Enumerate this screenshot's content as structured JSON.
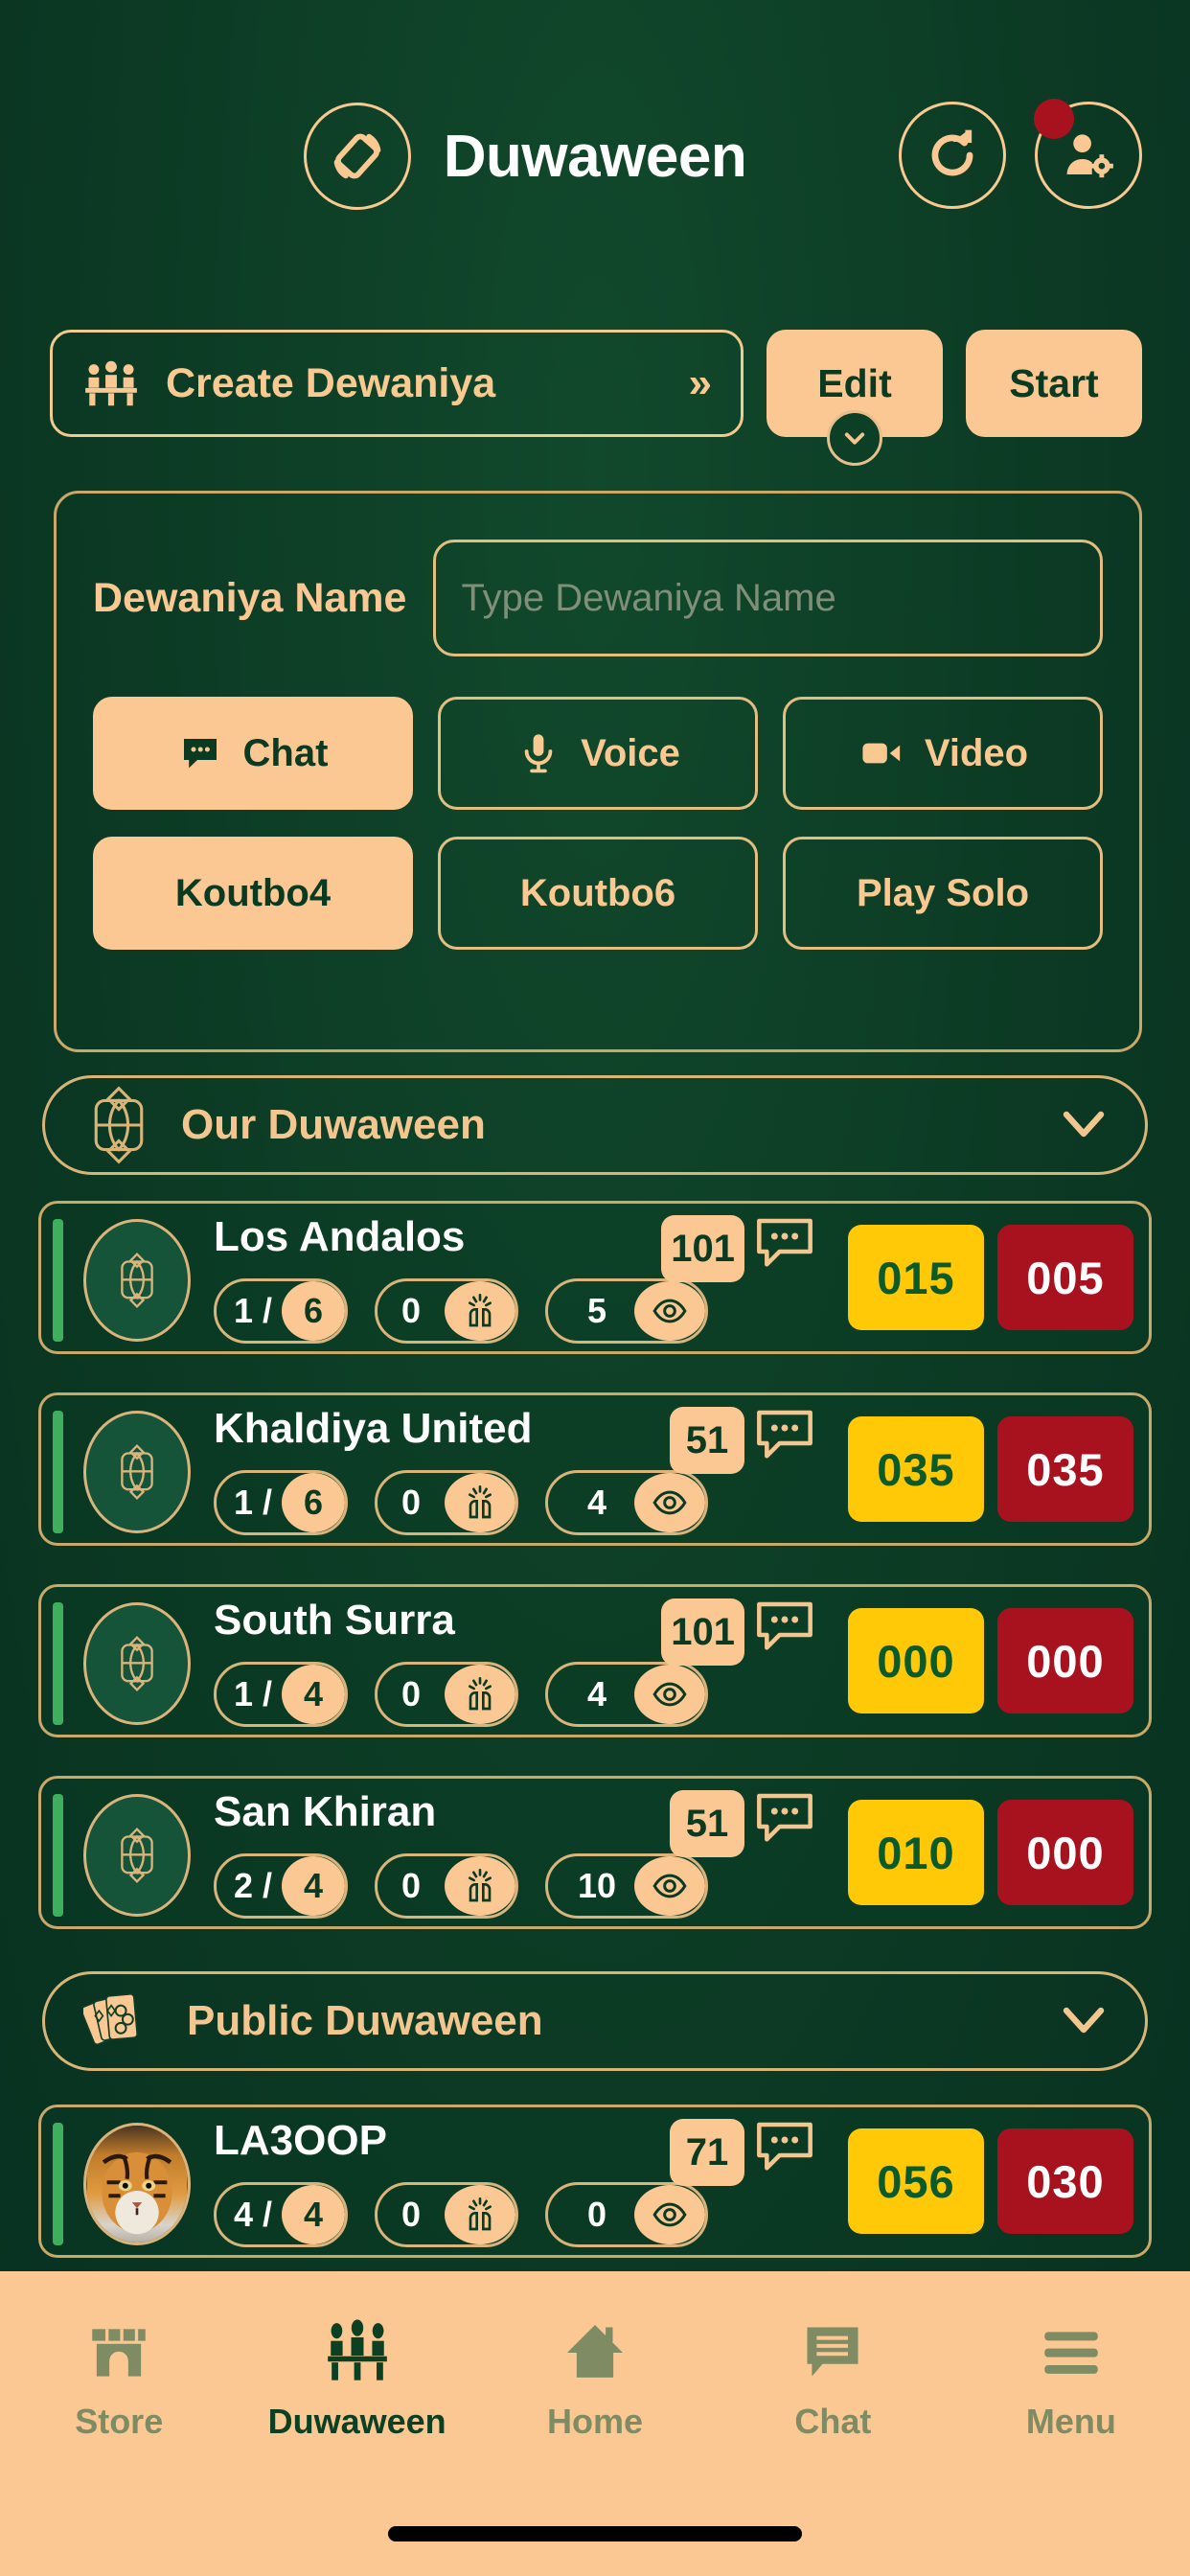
{
  "header": {
    "title": "Duwaween",
    "rotate_icon": "rotate-device-icon",
    "refresh_icon": "refresh-icon",
    "profile_settings_icon": "user-settings-icon",
    "notification_badge": true
  },
  "actions": {
    "create_label": "Create Dewaniya",
    "create_icon": "people-at-table-icon",
    "create_chevron": "»",
    "edit_label": "Edit",
    "start_label": "Start",
    "edit_expand_icon": "chevron-down-icon"
  },
  "form": {
    "name_label": "Dewaniya Name",
    "name_placeholder": "Type Dewaniya Name",
    "name_value": "",
    "mode_options": [
      {
        "label": "Chat",
        "icon": "chat-bubble-icon",
        "selected": true
      },
      {
        "label": "Voice",
        "icon": "microphone-icon",
        "selected": false
      },
      {
        "label": "Video",
        "icon": "video-camera-icon",
        "selected": false
      }
    ],
    "game_options": [
      {
        "label": "Koutbo4",
        "selected": true
      },
      {
        "label": "Koutbo6",
        "selected": false
      },
      {
        "label": "Play Solo",
        "selected": false
      }
    ]
  },
  "sections": [
    {
      "title": "Our Duwaween",
      "icon": "arabesque-ornament-icon",
      "chevron": "chevron-down-icon",
      "rows": [
        {
          "name": "Los Andalos",
          "avatar": "arabesque-ornament-icon",
          "seats_current": "1",
          "seats_total": "6",
          "claps": "0",
          "views": "5",
          "messages": "101",
          "score_yellow": "015",
          "score_red": "005"
        },
        {
          "name": "Khaldiya United",
          "avatar": "arabesque-ornament-icon",
          "seats_current": "1",
          "seats_total": "6",
          "claps": "0",
          "views": "4",
          "messages": "51",
          "score_yellow": "035",
          "score_red": "035"
        },
        {
          "name": "South Surra",
          "avatar": "arabesque-ornament-icon",
          "seats_current": "1",
          "seats_total": "4",
          "claps": "0",
          "views": "4",
          "messages": "101",
          "score_yellow": "000",
          "score_red": "000"
        },
        {
          "name": "San Khiran",
          "avatar": "arabesque-ornament-icon",
          "seats_current": "2",
          "seats_total": "4",
          "claps": "0",
          "views": "10",
          "messages": "51",
          "score_yellow": "010",
          "score_red": "000"
        }
      ]
    },
    {
      "title": "Public Duwaween",
      "icon": "playing-cards-icon",
      "chevron": "chevron-down-icon",
      "rows": [
        {
          "name": "LA3OOP",
          "avatar": "tiger-photo",
          "seats_current": "4",
          "seats_total": "4",
          "claps": "0",
          "views": "0",
          "messages": "71",
          "score_yellow": "056",
          "score_red": "030"
        }
      ]
    }
  ],
  "bottom_nav": [
    {
      "label": "Store",
      "icon": "store-icon",
      "active": false
    },
    {
      "label": "Duwaween",
      "icon": "people-at-table-icon",
      "active": true
    },
    {
      "label": "Home",
      "icon": "home-icon",
      "active": false
    },
    {
      "label": "Chat",
      "icon": "chat-bubble-icon",
      "active": false
    },
    {
      "label": "Menu",
      "icon": "hamburger-menu-icon",
      "active": false
    }
  ],
  "colors": {
    "background_green": "#0c3a24",
    "accent_peach": "#FBC893",
    "gold_border": "#D9B47C",
    "score_yellow": "#FFC907",
    "score_red": "#A8121F",
    "status_green": "#3FAF5E",
    "notification_red": "#A8121F"
  }
}
